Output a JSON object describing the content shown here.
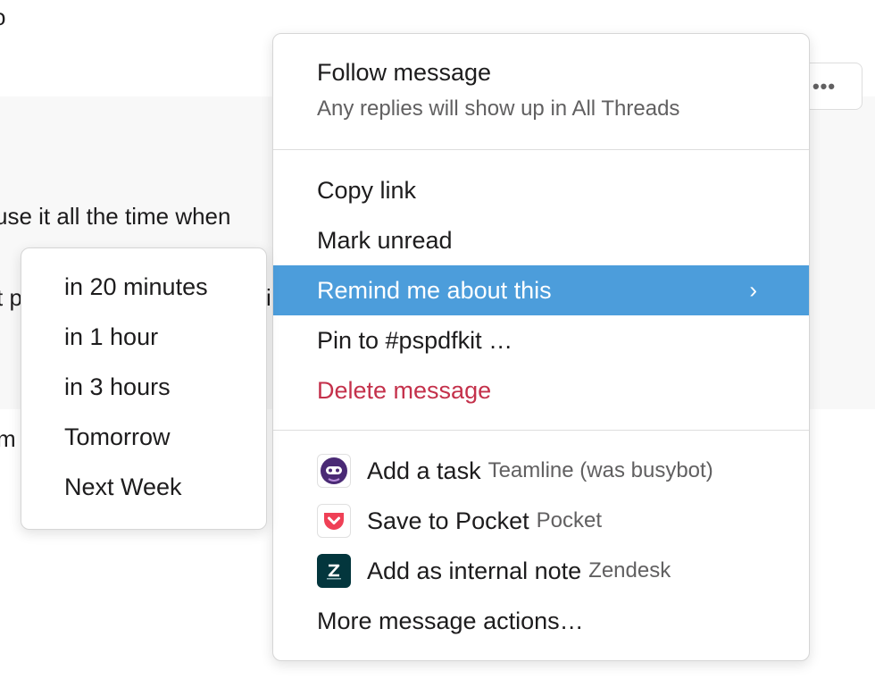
{
  "background": {
    "fragments": [
      "o",
      "use it all the time when",
      "t p",
      "i",
      "m"
    ]
  },
  "more_button": {
    "label": "•••",
    "icon": "ellipsis-icon"
  },
  "menu": {
    "follow": {
      "title": "Follow message",
      "subtitle": "Any replies will show up in All Threads"
    },
    "items": [
      {
        "label": "Copy link"
      },
      {
        "label": "Mark unread"
      },
      {
        "label": "Remind me about this",
        "highlighted": true,
        "chevron": "›"
      },
      {
        "label": "Pin to #pspdfkit …"
      },
      {
        "label": "Delete message",
        "danger": true
      }
    ],
    "app_actions": [
      {
        "label": "Add a task",
        "app": "Teamline (was busybot)",
        "icon": "teamline-icon",
        "icon_color": "#4a2a75"
      },
      {
        "label": "Save to Pocket",
        "app": "Pocket",
        "icon": "pocket-icon",
        "icon_color": "#ef4056"
      },
      {
        "label": "Add as internal note",
        "app": "Zendesk",
        "icon": "zendesk-icon",
        "icon_color": "#03363d"
      }
    ],
    "more_actions": "More message actions…"
  },
  "submenu": {
    "items": [
      {
        "label": "in 20 minutes"
      },
      {
        "label": "in 1 hour"
      },
      {
        "label": "in 3 hours"
      },
      {
        "label": "Tomorrow"
      },
      {
        "label": "Next Week"
      }
    ]
  },
  "colors": {
    "highlight": "#4c9ddb",
    "danger": "#c4314b",
    "muted_text": "#616061"
  }
}
